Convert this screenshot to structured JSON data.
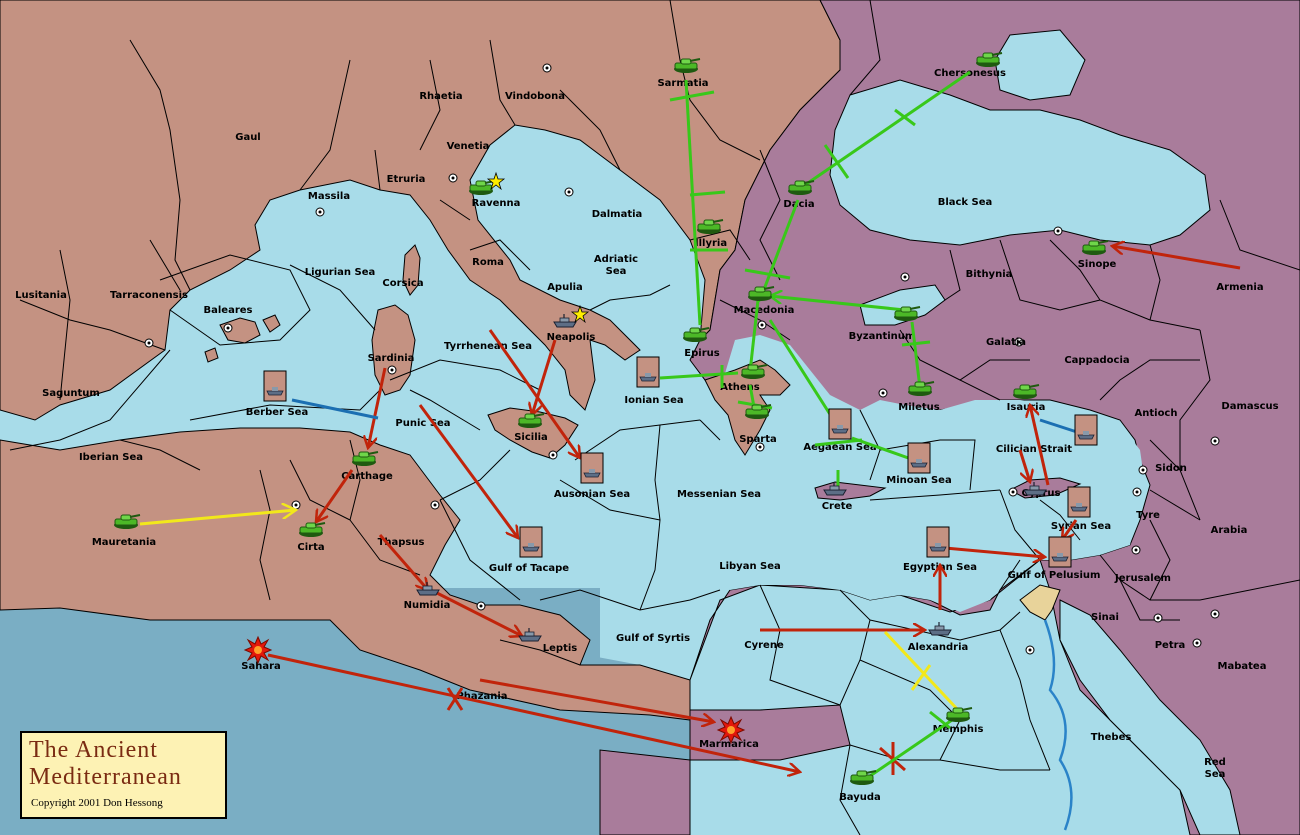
{
  "title": {
    "line1": "The Ancient",
    "line2": "Mediterranean",
    "copyright": "Copyright  2001  Don Hessong"
  },
  "colors": {
    "sea": "#a8dce9",
    "deep_sea": "#7aaec4",
    "land_west": "#c49282",
    "land_east": "#a97c9b",
    "move_arrow": "#c1240b",
    "support_green": "#38c81a",
    "convoy_yellow": "#f2e81b",
    "convoy_blue": "#1b6fb2",
    "title_bg": "#fdf2b4",
    "title_text": "#7a2b12"
  },
  "regions": [
    {
      "name": "Rhaetia"
    },
    {
      "name": "Vindobona"
    },
    {
      "name": "Sarmatia"
    },
    {
      "name": "Chersonesus"
    },
    {
      "name": "Gaul"
    },
    {
      "name": "Venetia"
    },
    {
      "name": "Etruria"
    },
    {
      "name": "Ravenna"
    },
    {
      "name": "Massila"
    },
    {
      "name": "Dalmatia"
    },
    {
      "name": "Dacia"
    },
    {
      "name": "Black Sea"
    },
    {
      "name": "Illyria"
    },
    {
      "name": "Ligurian Sea"
    },
    {
      "name": "Roma"
    },
    {
      "name": "Adriatic Sea"
    },
    {
      "name": "Corsica"
    },
    {
      "name": "Apulia"
    },
    {
      "name": "Bithynia"
    },
    {
      "name": "Sinope"
    },
    {
      "name": "Armenia"
    },
    {
      "name": "Lusitania"
    },
    {
      "name": "Tarraconensis"
    },
    {
      "name": "Baleares"
    },
    {
      "name": "Macedonia"
    },
    {
      "name": "Byzantinum"
    },
    {
      "name": "Neapolis"
    },
    {
      "name": "Sardinia"
    },
    {
      "name": "Tyrrhenean Sea"
    },
    {
      "name": "Epirus"
    },
    {
      "name": "Galatia"
    },
    {
      "name": "Cappadocia"
    },
    {
      "name": "Athens"
    },
    {
      "name": "Saguntum"
    },
    {
      "name": "Berber Sea"
    },
    {
      "name": "Ionian Sea"
    },
    {
      "name": "Miletus"
    },
    {
      "name": "Isauria"
    },
    {
      "name": "Antioch"
    },
    {
      "name": "Damascus"
    },
    {
      "name": "Punic Sea"
    },
    {
      "name": "Sicilia"
    },
    {
      "name": "Sparta"
    },
    {
      "name": "Aegaean Sea"
    },
    {
      "name": "Cilician Strait"
    },
    {
      "name": "Iberian Sea"
    },
    {
      "name": "Carthage"
    },
    {
      "name": "Minoan Sea"
    },
    {
      "name": "Sidon"
    },
    {
      "name": "Ausonian Sea"
    },
    {
      "name": "Messenian Sea"
    },
    {
      "name": "Crete"
    },
    {
      "name": "Cyprus"
    },
    {
      "name": "Tyre"
    },
    {
      "name": "Mauretania"
    },
    {
      "name": "Cirta"
    },
    {
      "name": "Syrian Sea"
    },
    {
      "name": "Arabia"
    },
    {
      "name": "Thapsus"
    },
    {
      "name": "Gulf of Tacape"
    },
    {
      "name": "Libyan Sea"
    },
    {
      "name": "Egyptian Sea"
    },
    {
      "name": "Gulf of Pelusium"
    },
    {
      "name": "Jerusalem"
    },
    {
      "name": "Numidia"
    },
    {
      "name": "Leptis"
    },
    {
      "name": "Gulf of Syrtis"
    },
    {
      "name": "Sinai"
    },
    {
      "name": "Cyrene"
    },
    {
      "name": "Alexandria"
    },
    {
      "name": "Petra"
    },
    {
      "name": "Sahara"
    },
    {
      "name": "Mabatea"
    },
    {
      "name": "Phazania"
    },
    {
      "name": "Memphis"
    },
    {
      "name": "Thebes"
    },
    {
      "name": "Marmarica"
    },
    {
      "name": "Red Sea"
    },
    {
      "name": "Bayuda"
    }
  ]
}
